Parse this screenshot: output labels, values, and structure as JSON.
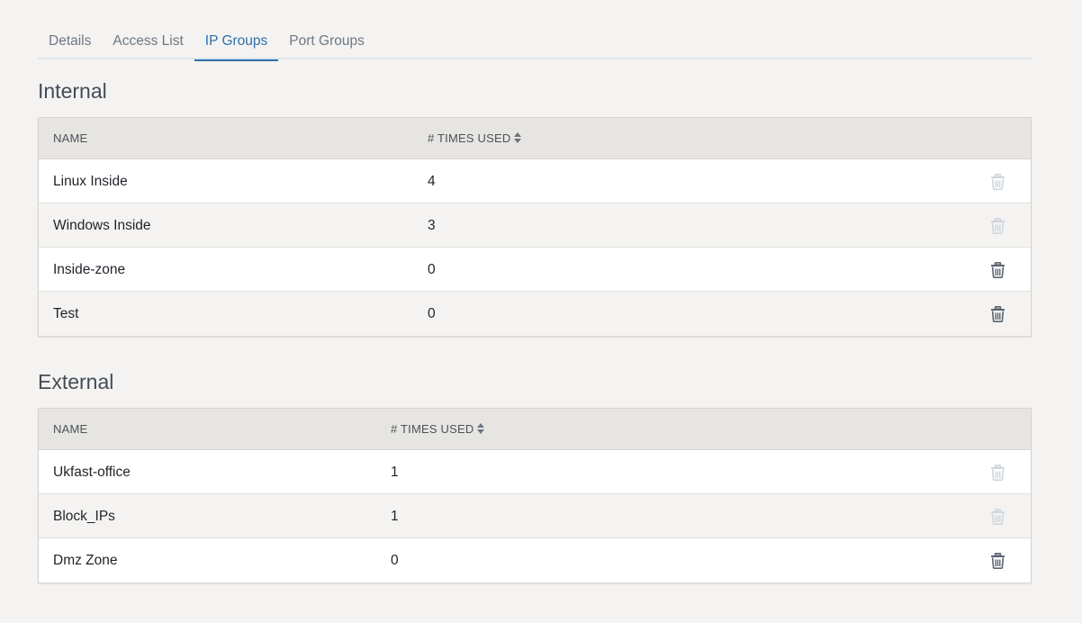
{
  "tabs": [
    {
      "label": "Details",
      "active": false
    },
    {
      "label": "Access List",
      "active": false
    },
    {
      "label": "IP Groups",
      "active": true
    },
    {
      "label": "Port Groups",
      "active": false
    }
  ],
  "colors": {
    "active_tab": "#2e6fab",
    "delete_enabled": "#5a6470",
    "delete_disabled": "#cfd6de"
  },
  "internal": {
    "title": "Internal",
    "columns": {
      "name": "NAME",
      "times_used": "# TIMES USED"
    },
    "rows": [
      {
        "name": "Linux Inside",
        "times_used": "4",
        "delete_enabled": false
      },
      {
        "name": "Windows Inside",
        "times_used": "3",
        "delete_enabled": false
      },
      {
        "name": "Inside-zone",
        "times_used": "0",
        "delete_enabled": true
      },
      {
        "name": "Test",
        "times_used": "0",
        "delete_enabled": true
      }
    ]
  },
  "external": {
    "title": "External",
    "columns": {
      "name": "NAME",
      "times_used": "# TIMES USED"
    },
    "rows": [
      {
        "name": "Ukfast-office",
        "times_used": "1",
        "delete_enabled": false
      },
      {
        "name": "Block_IPs",
        "times_used": "1",
        "delete_enabled": false
      },
      {
        "name": "Dmz Zone",
        "times_used": "0",
        "delete_enabled": true
      }
    ]
  }
}
